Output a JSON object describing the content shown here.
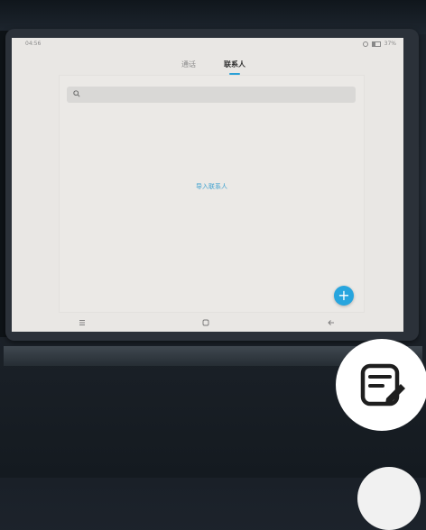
{
  "status_bar": {
    "time": "04:56",
    "battery": "37%"
  },
  "tabs": [
    {
      "label": "通话"
    },
    {
      "label": "联系人"
    }
  ],
  "search": {
    "placeholder": ""
  },
  "contacts": {
    "empty_action": "导入联系人"
  },
  "fab": {
    "glyph": "+"
  },
  "colors": {
    "accent": "#27a5de",
    "screen_bg": "#e9e7e4"
  },
  "icons": {
    "menu": "menu-icon",
    "home": "home-icon",
    "back": "back-icon",
    "search": "search-icon",
    "edit": "note-edit-icon"
  }
}
